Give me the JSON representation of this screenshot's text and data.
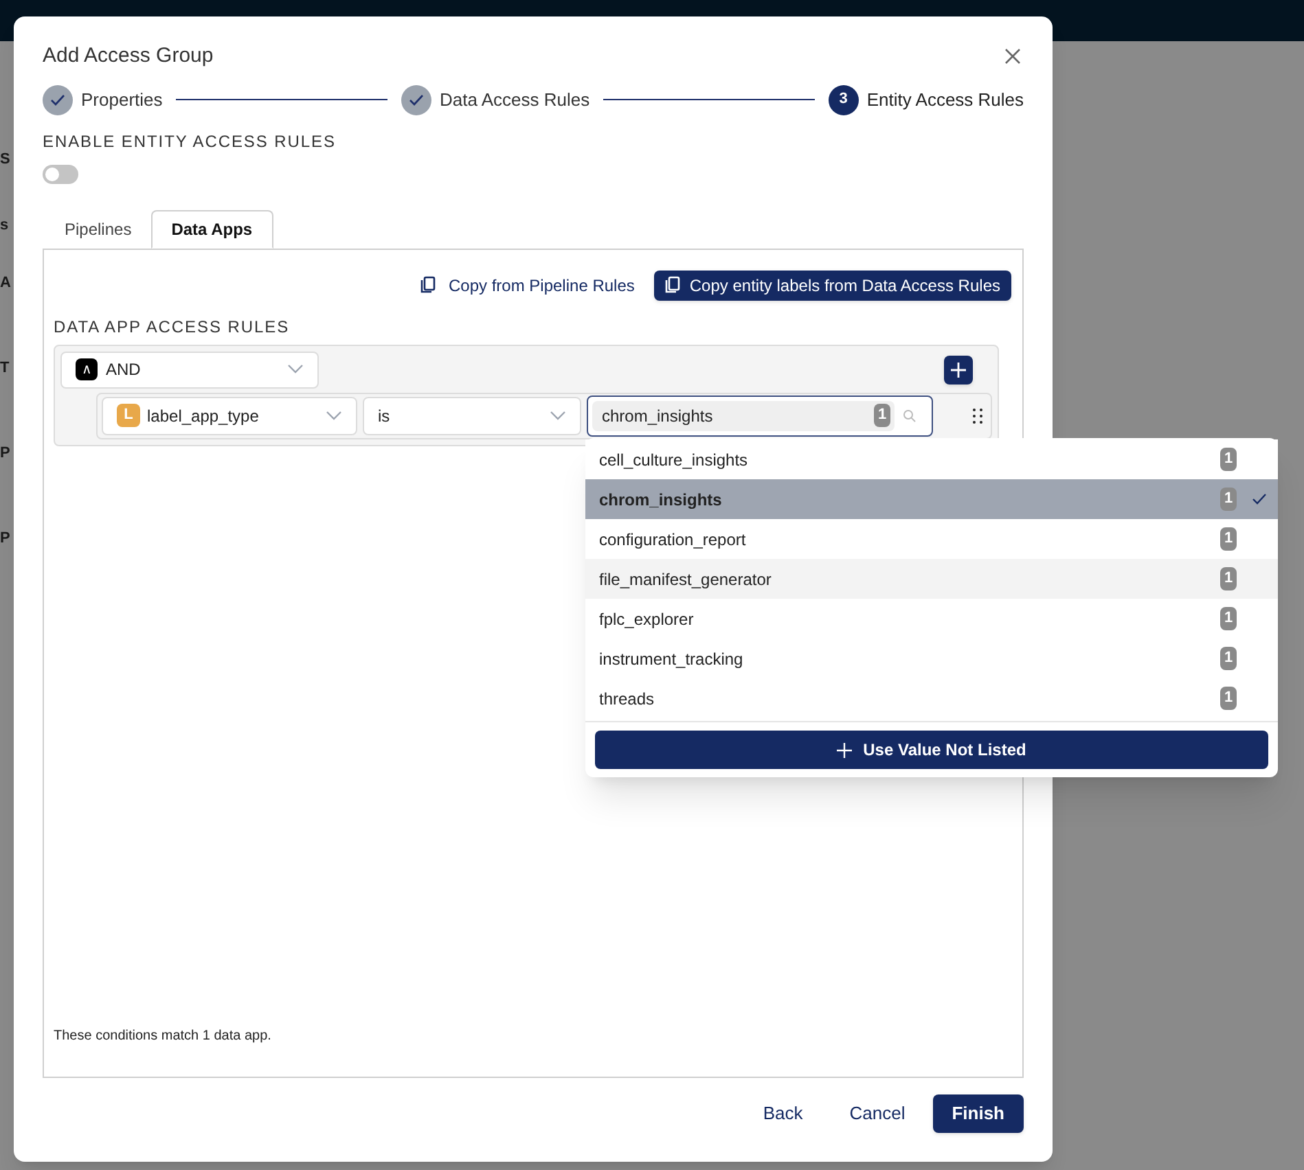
{
  "background_fragments": [
    "S",
    "s",
    "A",
    "T",
    "P",
    "P"
  ],
  "dialog": {
    "title": "Add Access Group",
    "steps": [
      {
        "label": "Properties",
        "completed": true
      },
      {
        "label": "Data Access Rules",
        "completed": true
      },
      {
        "label": "Entity Access Rules",
        "completed": false,
        "number": "3"
      }
    ],
    "enable_label": "ENABLE ENTITY ACCESS RULES",
    "enable_on": false,
    "tabs": [
      {
        "label": "Pipelines",
        "selected": false
      },
      {
        "label": "Data Apps",
        "selected": true
      }
    ],
    "copy_buttons": [
      {
        "label": "Copy from Pipeline Rules",
        "kind": "link"
      },
      {
        "label": "Copy entity labels from Data Access Rules",
        "kind": "primary"
      }
    ],
    "section_label": "DATA APP ACCESS RULES",
    "operator": {
      "icon": "∧",
      "value": "AND"
    },
    "condition": {
      "field_badge": "L",
      "field": "label_app_type",
      "comparator": "is",
      "value": "chrom_insights",
      "value_count": "1"
    },
    "dropdown": {
      "options": [
        {
          "label": "cell_culture_insights",
          "count": "1",
          "selected": false,
          "highlighted": false
        },
        {
          "label": "chrom_insights",
          "count": "1",
          "selected": true,
          "highlighted": false
        },
        {
          "label": "configuration_report",
          "count": "1",
          "selected": false,
          "highlighted": false
        },
        {
          "label": "file_manifest_generator",
          "count": "1",
          "selected": false,
          "highlighted": true
        },
        {
          "label": "fplc_explorer",
          "count": "1",
          "selected": false,
          "highlighted": false
        },
        {
          "label": "instrument_tracking",
          "count": "1",
          "selected": false,
          "highlighted": false
        },
        {
          "label": "threads",
          "count": "1",
          "selected": false,
          "highlighted": false
        }
      ],
      "action": "Use Value Not Listed"
    },
    "match_text": "These conditions match 1 data app.",
    "buttons": [
      {
        "label": "Back",
        "kind": "text"
      },
      {
        "label": "Cancel",
        "kind": "text"
      },
      {
        "label": "Finish",
        "kind": "primary"
      }
    ]
  }
}
